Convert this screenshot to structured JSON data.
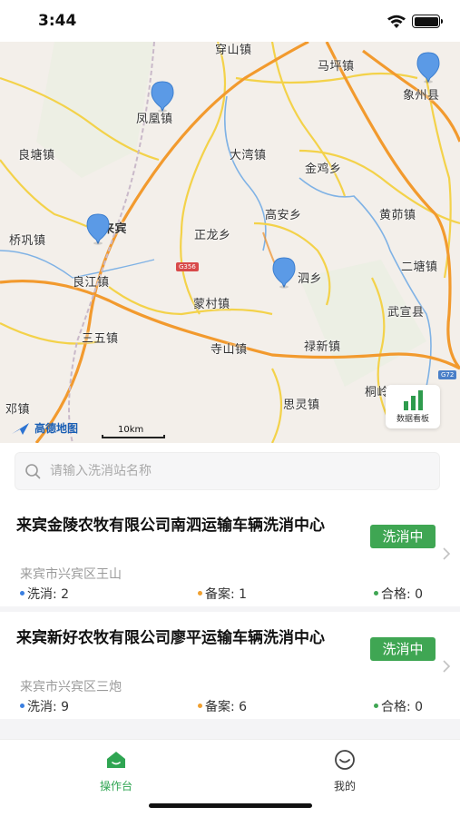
{
  "status_bar": {
    "time": "3:44"
  },
  "map": {
    "places": [
      {
        "name": "穿山镇"
      },
      {
        "name": "马坪镇"
      },
      {
        "name": "象州县"
      },
      {
        "name": "凤凰镇"
      },
      {
        "name": "良塘镇"
      },
      {
        "name": "大湾镇"
      },
      {
        "name": "金鸡乡"
      },
      {
        "name": "高安乡"
      },
      {
        "name": "黄茆镇"
      },
      {
        "name": "桥巩镇"
      },
      {
        "name": "来宾"
      },
      {
        "name": "正龙乡"
      },
      {
        "name": "二塘镇"
      },
      {
        "name": "良江镇"
      },
      {
        "name": "泗乡"
      },
      {
        "name": "蒙村镇"
      },
      {
        "name": "武宣县"
      },
      {
        "name": "三五镇"
      },
      {
        "name": "寺山镇"
      },
      {
        "name": "禄新镇"
      },
      {
        "name": "桐岭镇"
      },
      {
        "name": "邓镇"
      },
      {
        "name": "思灵镇"
      }
    ],
    "road_badges": [
      "G356",
      "G72"
    ],
    "logo_text": "高德地图",
    "scale_label": "10km",
    "dashboard_label": "数据看板"
  },
  "search": {
    "placeholder": "请输入洗消站名称"
  },
  "stations": [
    {
      "name": "来宾金陵农牧有限公司南泗运输车辆洗消中心",
      "status": "洗消中",
      "address": "来宾市兴宾区王山",
      "wash_label": "洗消: 2",
      "record_label": "备案: 1",
      "pass_label": "合格: 0"
    },
    {
      "name": "来宾新好农牧有限公司廖平运输车辆洗消中心",
      "status": "洗消中",
      "address": "来宾市兴宾区三炮",
      "wash_label": "洗消: 9",
      "record_label": "备案: 6",
      "pass_label": "合格: 0"
    }
  ],
  "colors": {
    "accent_green": "#3fa653",
    "wash_dot": "#3b7fe0",
    "record_dot": "#f0a030",
    "pass_dot": "#3fa653"
  },
  "tabs": [
    {
      "label": "操作台",
      "icon": "home-icon",
      "active": true
    },
    {
      "label": "我的",
      "icon": "profile-icon",
      "active": false
    }
  ]
}
